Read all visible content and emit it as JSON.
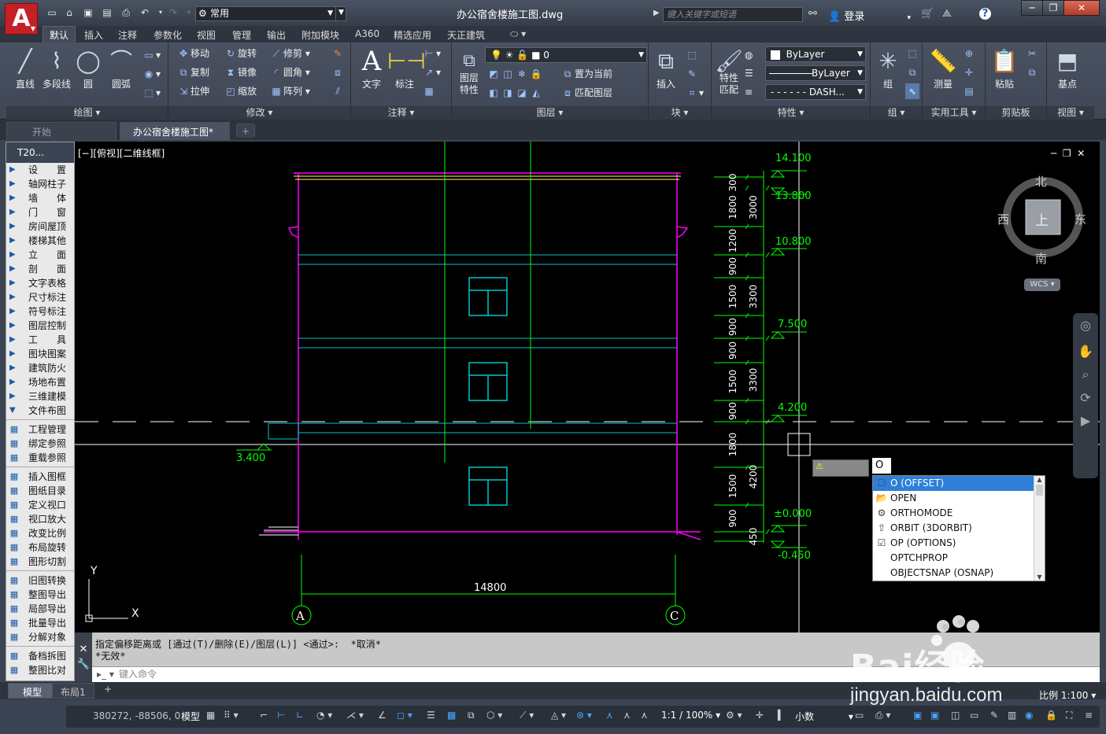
{
  "titlebar": {
    "app_logo": "A",
    "workspace": "常用",
    "document_title": "办公宿舍楼施工图.dwg",
    "search_placeholder": "键入关键字或短语",
    "login": "登录",
    "window_controls": [
      "─",
      "❐",
      "✕"
    ]
  },
  "menu": {
    "items": [
      "默认",
      "插入",
      "注释",
      "参数化",
      "视图",
      "管理",
      "输出",
      "附加模块",
      "A360",
      "精选应用",
      "天正建筑"
    ],
    "active": "默认"
  },
  "ribbon": {
    "draw": {
      "title": "绘图 ▾",
      "line": "直线",
      "polyline": "多段线",
      "circle": "圆",
      "arc": "圆弧"
    },
    "modify": {
      "title": "修改 ▾",
      "move": "移动",
      "rotate": "旋转",
      "trim": "修剪",
      "copy": "复制",
      "mirror": "镜像",
      "fillet": "圆角",
      "stretch": "拉伸",
      "scale": "缩放",
      "array": "阵列"
    },
    "annotation": {
      "title": "注释 ▾",
      "text": "文字",
      "dimension": "标注"
    },
    "layers": {
      "title": "图层 ▾",
      "layer_props": "图层\n特性",
      "current_layer": "0",
      "set_current": "置为当前",
      "match_layer": "匹配图层"
    },
    "block": {
      "title": "块 ▾",
      "insert": "插入"
    },
    "properties": {
      "title": "特性 ▾",
      "match": "特性\n匹配",
      "color": "ByLayer",
      "lineweight": "ByLayer",
      "linetype": "DASH..."
    },
    "groups": {
      "title": "组 ▾",
      "group": "组"
    },
    "utilities": {
      "title": "实用工具 ▾",
      "measure": "测量"
    },
    "clipboard": {
      "title": "剪贴板",
      "paste": "粘贴"
    },
    "view": {
      "title": "视图 ▾",
      "base": "基点"
    }
  },
  "file_tabs": {
    "start": "开始",
    "current": "办公宿舍楼施工图*",
    "close": "×",
    "add": "+"
  },
  "palette": {
    "title": "T20...",
    "groups1": [
      "设　　置",
      "轴网柱子",
      "墙　　体",
      "门　　窗",
      "房间屋顶",
      "楼梯其他",
      "立　　面",
      "剖　　面",
      "文字表格",
      "尺寸标注",
      "符号标注",
      "图层控制",
      "工　　具",
      "图块图案",
      "建筑防火",
      "场地布置",
      "三维建模",
      "文件布图"
    ],
    "groups2": [
      "工程管理",
      "绑定参照",
      "重载参照"
    ],
    "groups3": [
      "插入图框",
      "图纸目录",
      "定义视口",
      "视口放大",
      "改变比例",
      "布局旋转",
      "图形切割"
    ],
    "groups4": [
      "旧图转换",
      "整图导出",
      "局部导出",
      "批量导出",
      "分解对象"
    ],
    "groups5": [
      "备档拆图",
      "整图比对"
    ]
  },
  "viewport": {
    "label": "[−][俯视][二维线框]",
    "compass": {
      "north": "北",
      "south": "南",
      "east": "东",
      "west": "西",
      "top": "上"
    },
    "wcs": "WCS ▾",
    "elevations": [
      "14.100",
      "13.800",
      "10.800",
      "7.500",
      "4.200",
      "±0.000",
      "-0.450",
      "3.400"
    ],
    "dims": [
      "300",
      "1800",
      "3000",
      "1200",
      "900",
      "1500",
      "3300",
      "900",
      "900",
      "1500",
      "3300",
      "900",
      "1800",
      "1500",
      "4200",
      "900",
      "450"
    ],
    "width_dim": "14800",
    "axis_left": "A",
    "axis_right": "C",
    "ucs_x": "X",
    "ucs_y": "Y"
  },
  "autocomplete": {
    "typed": "O",
    "items": [
      "O (OFFSET)",
      "OPEN",
      "ORTHOMODE",
      "ORBIT (3DORBIT)",
      "OP (OPTIONS)",
      "OPTCHPROP",
      "OBJECTSNAP (OSNAP)"
    ],
    "selected": 0
  },
  "command": {
    "line1": "指定偏移距离或 [通过(T)/删除(E)/图层(L)] <通过>:  *取消*",
    "line2": "*无效*",
    "placeholder": "键入命令"
  },
  "layout_tabs": {
    "model": "模型",
    "layout1": "布局1",
    "add": "+"
  },
  "status": {
    "coords": "380272, -88506, 0",
    "model": "模型",
    "scale": "1:1 / 100%",
    "units": "小数",
    "ratio_label": "比例 1:100 ▾"
  },
  "watermark": {
    "brand": "Bai经验",
    "url": "jingyan.baidu.com"
  },
  "colors": {
    "magenta": "#ff00ff",
    "cyan": "#00c8c8",
    "green": "#00ff00",
    "yellow": "#ffff66",
    "white": "#ffffff",
    "selected": "#2f7fd8"
  }
}
